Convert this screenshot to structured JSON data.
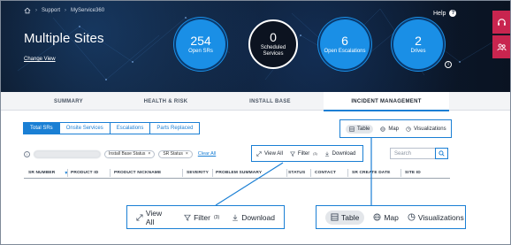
{
  "breadcrumb": {
    "items": [
      "Support",
      "MyService360"
    ],
    "home_icon": "home-icon"
  },
  "header": {
    "title": "Multiple Sites",
    "change_view": "Change View",
    "help_label": "Help",
    "help_icon": "?",
    "info_icon": "i"
  },
  "kpis": [
    {
      "value": "254",
      "label": "Open SRs",
      "style": "blue"
    },
    {
      "value": "0",
      "label": "Scheduled Services",
      "style": "dark"
    },
    {
      "value": "6",
      "label": "Open Escalations",
      "style": "blue"
    },
    {
      "value": "2",
      "label": "Drives",
      "style": "blue"
    }
  ],
  "side_tabs": [
    {
      "icon": "headset-icon"
    },
    {
      "icon": "users-icon"
    }
  ],
  "nav_tabs": [
    {
      "label": "SUMMARY",
      "active": false
    },
    {
      "label": "HEALTH & RISK",
      "active": false
    },
    {
      "label": "INSTALL BASE",
      "active": false
    },
    {
      "label": "INCIDENT MANAGEMENT",
      "active": true
    }
  ],
  "sub_tabs": [
    {
      "label": "Total SRs",
      "active": true
    },
    {
      "label": "Onsite Services",
      "active": false
    },
    {
      "label": "Escalations",
      "active": false
    },
    {
      "label": "Parts Replaced",
      "active": false
    }
  ],
  "filters": {
    "info_icon": "i",
    "chips": [
      {
        "label": "Install Base Status",
        "remove": "×"
      },
      {
        "label": "SR Status",
        "remove": "×"
      }
    ],
    "clear_all": "Clear All"
  },
  "search": {
    "placeholder": "Search"
  },
  "table": {
    "columns": [
      "SR NUMBER",
      "PRODUCT ID",
      "PRODUCT NICKNAME",
      "SEVERITY",
      "PROBLEM SUMMARY",
      "STATUS",
      "CONTACT",
      "SR CREATE DATE",
      "SITE ID"
    ]
  },
  "actions_toolbar": {
    "view_all": "View All",
    "filter": "Filter",
    "filter_count": "(3)",
    "download": "Download"
  },
  "view_toolbar": {
    "table": "Table",
    "map": "Map",
    "visualizations": "Visualizations",
    "active": "Table"
  },
  "colors": {
    "accent": "#1a7fd4",
    "kpi_blue": "#1a8fe6",
    "side_tab": "#c8254f",
    "hero_bg": "#0f1f36"
  }
}
